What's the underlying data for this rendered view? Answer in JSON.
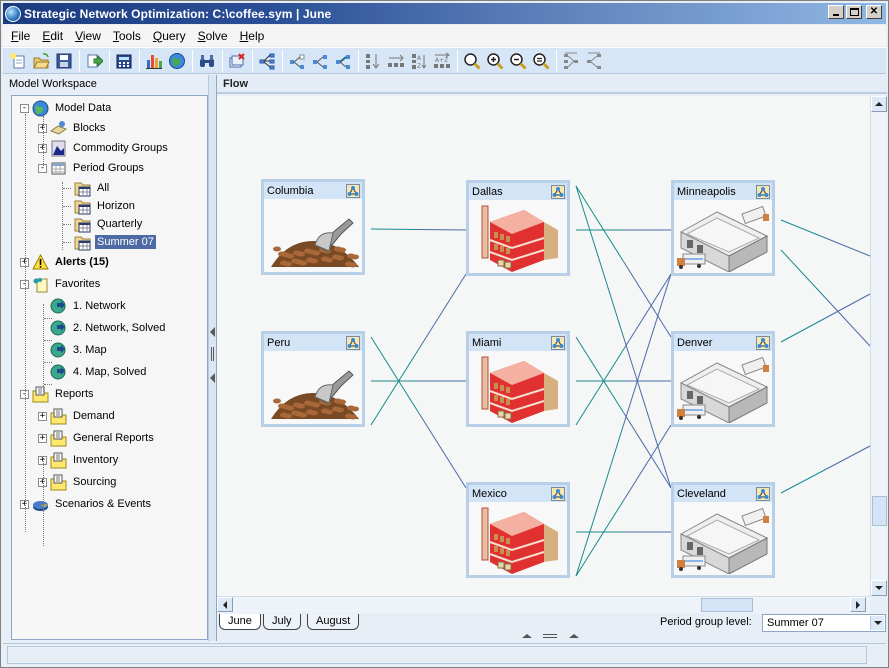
{
  "window": {
    "title": "Strategic Network Optimization:  C:\\coffee.sym | June",
    "controls": [
      "minimize",
      "maximize",
      "close"
    ]
  },
  "menubar": {
    "items": [
      {
        "label": "File",
        "accel": "F"
      },
      {
        "label": "Edit",
        "accel": "E"
      },
      {
        "label": "View",
        "accel": "V"
      },
      {
        "label": "Tools",
        "accel": "T"
      },
      {
        "label": "Query",
        "accel": "Q"
      },
      {
        "label": "Solve",
        "accel": "S"
      },
      {
        "label": "Help",
        "accel": "H"
      }
    ]
  },
  "toolbar": {
    "groups": [
      [
        "new-icon",
        "open-icon",
        "save-icon"
      ],
      [
        "export-icon"
      ],
      [
        "calculator-icon"
      ],
      [
        "bar-chart-icon",
        "globe-icon"
      ],
      [
        "binoculars-icon"
      ],
      [
        "delete-window-icon"
      ],
      [
        "network-tree-icon"
      ],
      [
        "node-select-icon",
        "node-connect-icon",
        "node-link-icon"
      ],
      [
        "sort-vertical-icon",
        "arrange-horizontal-icon",
        "sort-az-vertical-icon",
        "sort-az-horizontal-icon"
      ],
      [
        "zoom-icon",
        "zoom-in-icon",
        "zoom-out-icon",
        "zoom-fit-icon"
      ],
      [
        "collapse-left-icon",
        "expand-right-icon"
      ]
    ]
  },
  "workspace": {
    "title": "Model Workspace",
    "tree": [
      {
        "label": "Model Data",
        "level": 0,
        "expander": "-",
        "icon": "globe-icon"
      },
      {
        "label": "Blocks",
        "level": 1,
        "expander": "+",
        "icon": "blocks-icon"
      },
      {
        "label": "Commodity Groups",
        "level": 1,
        "expander": "+",
        "icon": "commodity-icon"
      },
      {
        "label": "Period Groups",
        "level": 1,
        "expander": "-",
        "icon": "calendar-icon"
      },
      {
        "label": "All",
        "level": 2,
        "icon": "period-folder-icon"
      },
      {
        "label": "Horizon",
        "level": 2,
        "icon": "period-folder-icon"
      },
      {
        "label": "Quarterly",
        "level": 2,
        "icon": "period-folder-icon"
      },
      {
        "label": "Summer 07",
        "level": 2,
        "icon": "period-folder-icon",
        "selected": true
      },
      {
        "label": "Alerts (15)",
        "level": 0,
        "expander": "+",
        "icon": "warning-icon",
        "bold": true
      },
      {
        "label": "Favorites",
        "level": 0,
        "expander": "-",
        "icon": "favorites-icon"
      },
      {
        "label": "1. Network",
        "level": 1,
        "icon": "favorite-link-icon"
      },
      {
        "label": "2. Network, Solved",
        "level": 1,
        "icon": "favorite-link-icon"
      },
      {
        "label": "3. Map",
        "level": 1,
        "icon": "favorite-link-icon"
      },
      {
        "label": "4. Map, Solved",
        "level": 1,
        "icon": "favorite-link-icon"
      },
      {
        "label": "Reports",
        "level": 0,
        "expander": "-",
        "icon": "report-folder-icon"
      },
      {
        "label": "Demand",
        "level": 1,
        "expander": "+",
        "icon": "report-folder-icon"
      },
      {
        "label": "General Reports",
        "level": 1,
        "expander": "+",
        "icon": "report-folder-icon"
      },
      {
        "label": "Inventory",
        "level": 1,
        "expander": "+",
        "icon": "report-folder-icon"
      },
      {
        "label": "Sourcing",
        "level": 1,
        "expander": "+",
        "icon": "report-folder-icon"
      },
      {
        "label": "Scenarios & Events",
        "level": 0,
        "expander": "+",
        "icon": "scenarios-icon"
      }
    ]
  },
  "flow": {
    "header": "Flow",
    "nodes": [
      {
        "id": "columbia",
        "label": "Columbia",
        "type": "supply"
      },
      {
        "id": "peru",
        "label": "Peru",
        "type": "supply"
      },
      {
        "id": "dallas",
        "label": "Dallas",
        "type": "plant"
      },
      {
        "id": "miami",
        "label": "Miami",
        "type": "plant"
      },
      {
        "id": "mexico",
        "label": "Mexico",
        "type": "plant"
      },
      {
        "id": "minneapolis",
        "label": "Minneapolis",
        "type": "warehouse"
      },
      {
        "id": "denver",
        "label": "Denver",
        "type": "warehouse"
      },
      {
        "id": "cleveland",
        "label": "Cleveland",
        "type": "warehouse"
      }
    ],
    "edges": [
      [
        "columbia",
        "dallas"
      ],
      [
        "peru",
        "dallas"
      ],
      [
        "peru",
        "miami"
      ],
      [
        "peru",
        "mexico"
      ],
      [
        "dallas",
        "minneapolis"
      ],
      [
        "dallas",
        "cleveland"
      ],
      [
        "dallas",
        "denver"
      ],
      [
        "miami",
        "minneapolis"
      ],
      [
        "miami",
        "denver"
      ],
      [
        "miami",
        "cleveland"
      ],
      [
        "mexico",
        "minneapolis"
      ],
      [
        "mexico",
        "denver"
      ],
      [
        "mexico",
        "cleveland"
      ],
      [
        "minneapolis",
        "offscreen-right"
      ],
      [
        "minneapolis",
        "offscreen-right-2"
      ],
      [
        "denver",
        "offscreen-right"
      ],
      [
        "cleveland",
        "offscreen-right"
      ]
    ],
    "colors": {
      "edge_teal": "#1a8a8a",
      "edge_blue": "#4a6aa8"
    }
  },
  "period_tabs": [
    {
      "label": "June",
      "active": true
    },
    {
      "label": "July",
      "active": false
    },
    {
      "label": "August",
      "active": false
    }
  ],
  "period_group": {
    "label": "Period group level:",
    "value": "Summer 07"
  },
  "status": {
    "text": ""
  }
}
